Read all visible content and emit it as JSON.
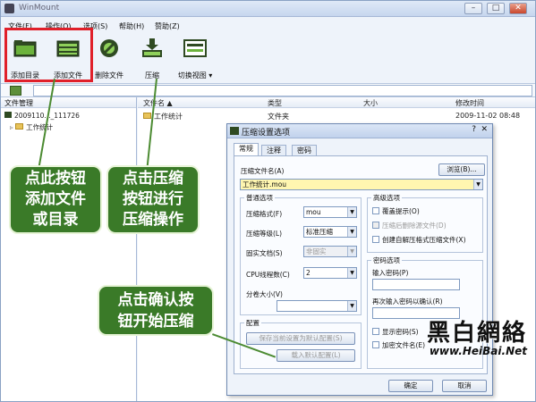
{
  "app": {
    "title": "WinMount"
  },
  "window_controls": {
    "minimize": "–",
    "maximize": "□",
    "close": "✕"
  },
  "menu": [
    "文件(F)",
    "操作(O)",
    "选项(S)",
    "帮助(H)",
    "赞助(Z)"
  ],
  "toolbar": {
    "add_dir": "添加目录",
    "add_file": "添加文件",
    "delete_file": "删除文件",
    "compress": "压缩",
    "switch_view": "切换视图 ▾"
  },
  "left_pane": {
    "header": "文件管理",
    "tree": [
      "2009110..._111726",
      "工作统计"
    ]
  },
  "file_list": {
    "columns": [
      "文件名 ▲",
      "类型",
      "大小",
      "修改时间"
    ],
    "rows": [
      {
        "name": "工作统计",
        "type": "文件夹",
        "size": "",
        "modified": "2009-11-02 08:48"
      }
    ]
  },
  "dialog": {
    "title": "压缩设置选项",
    "help": "?",
    "close": "✕",
    "tabs": [
      "常规",
      "注释",
      "密码"
    ],
    "archive_name_label": "压缩文件名(A)",
    "browse": "浏览(B)...",
    "archive_name_value": "工作统计.mou",
    "common_options": "普通选项",
    "format_label": "压缩格式(F)",
    "format_value": "mou",
    "level_label": "压缩等级(L)",
    "level_value": "标准压缩",
    "solid_label": "固实文档(S)",
    "solid_value": "非固实",
    "cpu_label": "CPU线程数(C)",
    "cpu_value": "2",
    "volume_label": "分卷大小(V)",
    "volume_value": "",
    "advanced": "高级选项",
    "adv_items": [
      "覆盖提示(O)",
      "压缩后删除源文件(D)",
      "创建自解压格式压缩文件(X)"
    ],
    "password_options": "密码选项",
    "password_label": "输入密码(P)",
    "password_confirm_label": "再次输入密码以确认(R)",
    "pwd_checks": [
      "显示密码(S)",
      "加密文件名(E)"
    ],
    "config": "配置",
    "save_default": "保存当前设置为默认配置(S)",
    "load_default": "载入默认配置(L)",
    "ok": "确定",
    "cancel": "取消"
  },
  "annotations": {
    "left": [
      "点此按钮",
      "添加文件",
      "或目录"
    ],
    "middle": [
      "点击压缩",
      "按钮进行",
      "压缩操作"
    ],
    "bottom": [
      "点击确认按",
      "钮开始压缩"
    ]
  },
  "watermark": {
    "cn": "黑白網絡",
    "url": "www.HeiBai.Net"
  }
}
